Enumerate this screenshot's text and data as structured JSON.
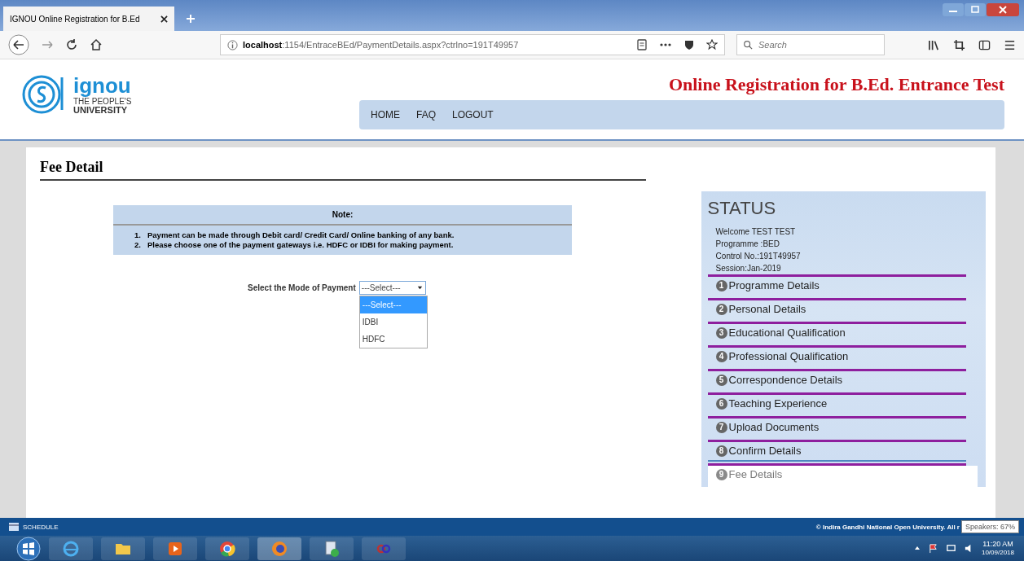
{
  "browser": {
    "tab_title": "IGNOU Online Registration for B.Ed",
    "url_host": "localhost",
    "url_rest": ":1154/EntraceBEd/PaymentDetails.aspx?ctrlno=191T49957",
    "search": {
      "placeholder": "Search"
    }
  },
  "header": {
    "logo_name": "ignou",
    "logo_tagline_1": "THE PEOPLE'S",
    "logo_tagline_2": "UNIVERSITY",
    "title": "Online Registration for B.Ed. Entrance Test",
    "nav": [
      "HOME",
      "FAQ",
      "LOGOUT"
    ]
  },
  "page": {
    "heading": "Fee Detail",
    "note": {
      "title": "Note:",
      "items": [
        {
          "num": "1.",
          "text": "Payment can be made through Debit card/ Credit Card/ Online banking of any bank."
        },
        {
          "num": "2.",
          "text": "Please choose one of the payment gateways i.e. HDFC or IDBI for making payment."
        }
      ]
    },
    "payment": {
      "label": "Select the Mode of Payment",
      "value": "---Select---",
      "expanded": true,
      "options": [
        {
          "label": "---Select---",
          "selected": true
        },
        {
          "label": "IDBI",
          "selected": false
        },
        {
          "label": "HDFC",
          "selected": false
        }
      ]
    }
  },
  "status": {
    "title": "STATUS",
    "info": [
      "Welcome TEST TEST",
      "Programme :BED",
      "Control No.:191T49957",
      "Session:Jan-2019"
    ],
    "steps": [
      {
        "num": "1",
        "label": "Programme Details",
        "disabled": false,
        "highlighted": false
      },
      {
        "num": "2",
        "label": "Personal Details",
        "disabled": false,
        "highlighted": false
      },
      {
        "num": "3",
        "label": "Educational Qualification",
        "disabled": false,
        "highlighted": false
      },
      {
        "num": "4",
        "label": "Professional Qualification",
        "disabled": false,
        "highlighted": false
      },
      {
        "num": "5",
        "label": "Correspondence Details",
        "disabled": false,
        "highlighted": false
      },
      {
        "num": "6",
        "label": "Teaching Experience",
        "disabled": false,
        "highlighted": false
      },
      {
        "num": "7",
        "label": "Upload Documents",
        "disabled": false,
        "highlighted": false
      },
      {
        "num": "8",
        "label": "Confirm Details",
        "disabled": false,
        "highlighted": true
      },
      {
        "num": "9",
        "label": "Fee Details",
        "disabled": true,
        "highlighted": false
      }
    ]
  },
  "footer": {
    "left": "SCHEDULE",
    "copyright": "© Indira Gandhi National Open University. All r",
    "tooltip": "Speakers: 67%"
  },
  "taskbar": {
    "time": "11:20 AM",
    "date": "10/09/2018"
  }
}
